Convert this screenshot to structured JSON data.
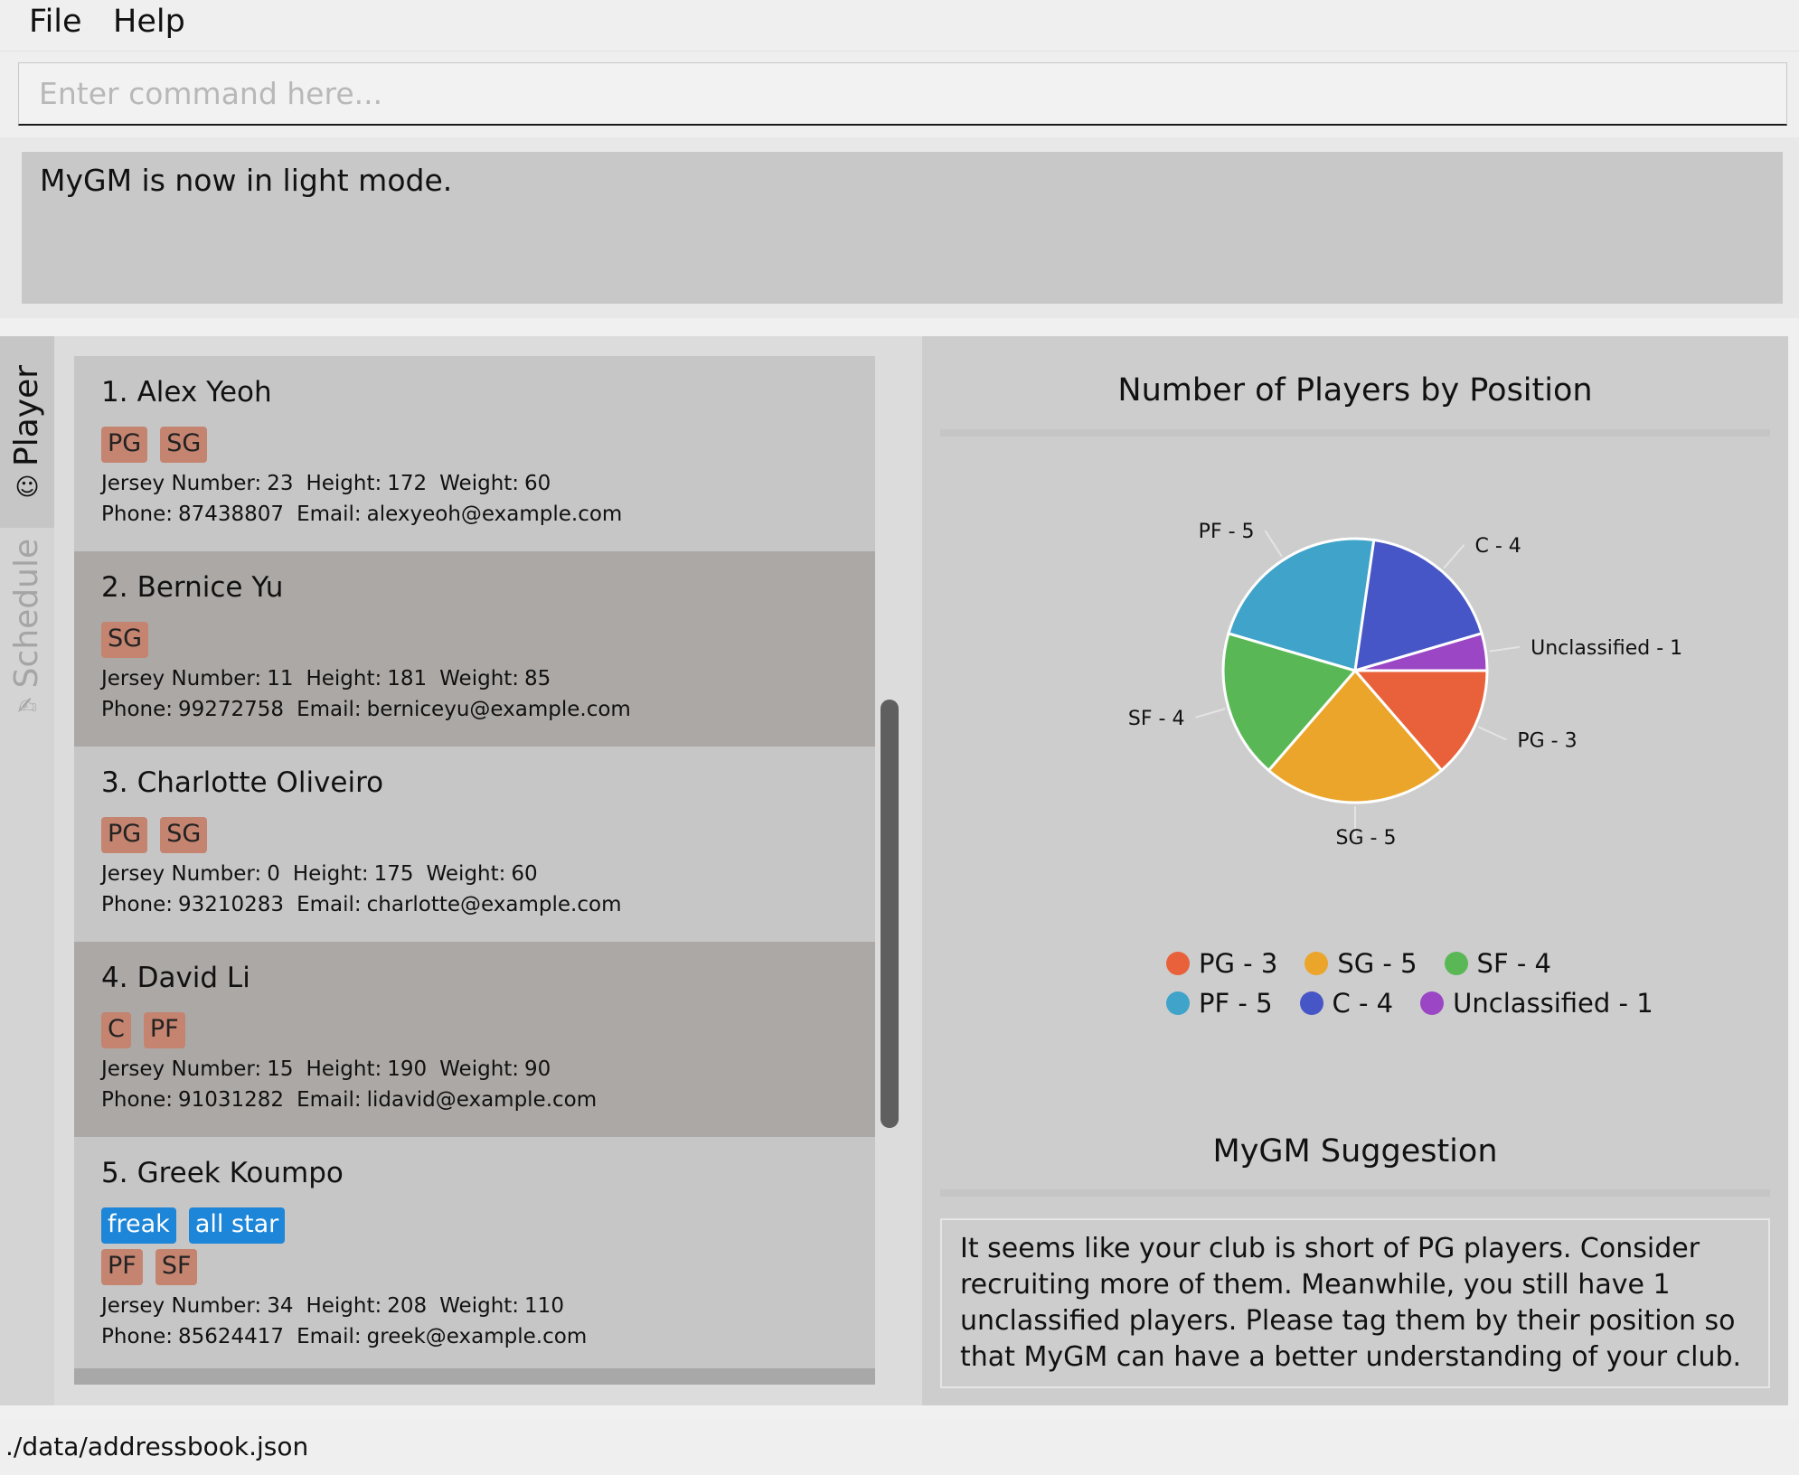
{
  "menu": {
    "file": "File",
    "help": "Help"
  },
  "command": {
    "placeholder": "Enter command here...",
    "value": ""
  },
  "result": {
    "text": "MyGM is now in light mode."
  },
  "tabs": {
    "player": "Player",
    "schedule": "Schedule"
  },
  "labels": {
    "jersey": "Jersey Number:",
    "height": "Height:",
    "weight": "Weight:",
    "phone": "Phone:",
    "email": "Email:"
  },
  "players": [
    {
      "index": "1.",
      "name": "Alex Yeoh",
      "custom_tags": [],
      "positions": [
        "PG",
        "SG"
      ],
      "jersey": "23",
      "height": "172",
      "weight": "60",
      "phone": "87438807",
      "email": "alexyeoh@example.com"
    },
    {
      "index": "2.",
      "name": "Bernice Yu",
      "custom_tags": [],
      "positions": [
        "SG"
      ],
      "jersey": "11",
      "height": "181",
      "weight": "85",
      "phone": "99272758",
      "email": "berniceyu@example.com"
    },
    {
      "index": "3.",
      "name": "Charlotte Oliveiro",
      "custom_tags": [],
      "positions": [
        "PG",
        "SG"
      ],
      "jersey": "0",
      "height": "175",
      "weight": "60",
      "phone": "93210283",
      "email": "charlotte@example.com"
    },
    {
      "index": "4.",
      "name": "David Li",
      "custom_tags": [],
      "positions": [
        "C",
        "PF"
      ],
      "jersey": "15",
      "height": "190",
      "weight": "90",
      "phone": "91031282",
      "email": "lidavid@example.com"
    },
    {
      "index": "5.",
      "name": "Greek Koumpo",
      "custom_tags": [
        "freak",
        "all star"
      ],
      "positions": [
        "PF",
        "SF"
      ],
      "jersey": "34",
      "height": "208",
      "weight": "110",
      "phone": "85624417",
      "email": "greek@example.com"
    }
  ],
  "chart_data": {
    "type": "pie",
    "title": "Number of Players by Position",
    "slices": [
      {
        "label": "PG - 3",
        "value": 3,
        "color": "#e8613a"
      },
      {
        "label": "SG - 5",
        "value": 5,
        "color": "#eba52b"
      },
      {
        "label": "SF - 4",
        "value": 4,
        "color": "#59b855"
      },
      {
        "label": "PF - 5",
        "value": 5,
        "color": "#40a3c9"
      },
      {
        "label": "C - 4",
        "value": 4,
        "color": "#4756c6"
      },
      {
        "label": "Unclassified - 1",
        "value": 1,
        "color": "#9b46c4"
      }
    ],
    "legend_placement": "bottom"
  },
  "suggestion": {
    "title": "MyGM Suggestion",
    "text": "It seems like your club is short of PG players. Consider recruiting more of them. Meanwhile, you still have 1 unclassified players. Please tag them by their position so that MyGM can have a better understanding of your club."
  },
  "status": {
    "path": "./data/addressbook.json"
  },
  "icons": {
    "player_tab": "smiley-icon",
    "schedule_tab": "pencil-icon"
  }
}
